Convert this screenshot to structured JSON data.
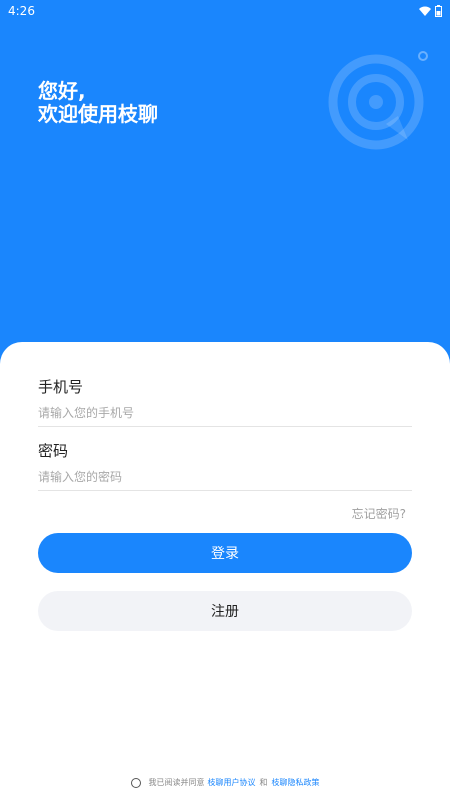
{
  "status_bar": {
    "time": "4:26",
    "wifi_icon": "wifi-icon",
    "battery_icon": "battery-icon"
  },
  "greeting": {
    "line1": "您好,",
    "line2": "欢迎使用枝聊"
  },
  "form": {
    "phone_label": "手机号",
    "phone_placeholder": "请输入您的手机号",
    "phone_value": "",
    "password_label": "密码",
    "password_placeholder": "请输入您的密码",
    "password_value": "",
    "forgot_label": "忘记密码?"
  },
  "buttons": {
    "login_label": "登录",
    "register_label": "注册"
  },
  "agreement": {
    "prefix": "我已阅读并同意",
    "user_agreement": "枝聊用户协议",
    "conjunction": "和",
    "privacy_policy": "枝聊隐私政策"
  },
  "colors": {
    "primary": "#1a86fd",
    "card_background": "#ffffff",
    "register_button": "#f2f3f7"
  }
}
